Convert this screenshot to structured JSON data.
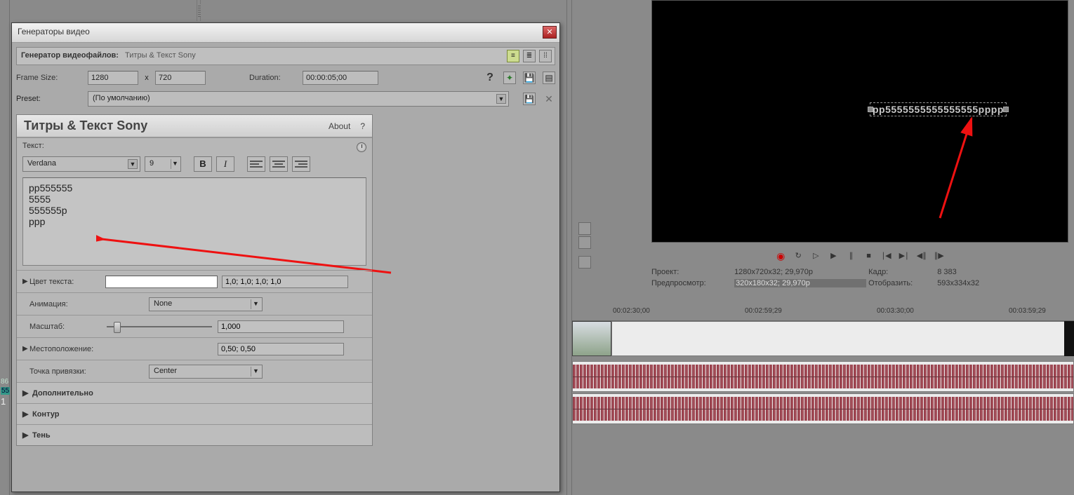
{
  "dialog": {
    "title": "Генераторы видео",
    "generator_label": "Генератор видеофайлов:",
    "generator_value": "Титры & Текст Sony",
    "frame_size_label": "Frame Size:",
    "frame_w": "1280",
    "frame_h": "720",
    "x": "x",
    "duration_label": "Duration:",
    "duration_value": "00:00:05;00",
    "preset_label": "Preset:",
    "preset_value": "(По умолчанию)"
  },
  "fx": {
    "title": "Титры & Текст Sony",
    "about": "About",
    "help": "?",
    "text_label": "Текст:",
    "font": "Verdana",
    "size": "9",
    "textarea": "pp555555\n5555\n555555p\nppp",
    "text_color_label": "Цвет текста:",
    "text_color_value": "1,0; 1,0; 1,0; 1,0",
    "animation_label": "Анимация:",
    "animation_value": "None",
    "scale_label": "Масштаб:",
    "scale_value": "1,000",
    "position_label": "Местоположение:",
    "position_value": "0,50; 0,50",
    "anchor_label": "Точка привязки:",
    "anchor_value": "Center",
    "more_label": "Дополнительно",
    "outline_label": "Контур",
    "shadow_label": "Тень"
  },
  "preview": {
    "text": "pp5555555555555555pppp",
    "project_label": "Проект:",
    "project_value": "1280x720x32; 29,970p",
    "frame_label": "Кадр:",
    "frame_value": "8 383",
    "previewres_label": "Предпросмотр:",
    "previewres_value": "320x180x32; 29,970p",
    "display_label": "Отобразить:",
    "display_value": "593x334x32"
  },
  "timeline": {
    "t1": "00:02:30;00",
    "t2": "00:02:59;29",
    "t3": "00:03:30;00",
    "t4": "00:03:59;29"
  },
  "leftnums": {
    "a": "86",
    "b": "55",
    "c": "1"
  }
}
